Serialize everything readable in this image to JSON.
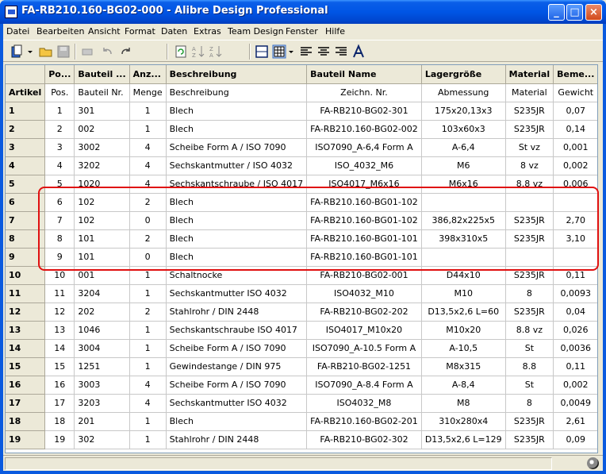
{
  "window": {
    "title": "FA-RB210.160-BG02-000 - Alibre Design Professional",
    "min": "_",
    "max": "□",
    "close": "×"
  },
  "menu": [
    "Datei",
    "Bearbeiten",
    "Ansicht",
    "Format",
    "Daten",
    "Extras",
    "Team Design",
    "Fenster",
    "Hilfe"
  ],
  "grid": {
    "columns": [
      "Po...",
      "Bauteil ...",
      "Anz...",
      "Beschreibung",
      "Bauteil Name",
      "Lagergröße",
      "Material",
      "Beme..."
    ],
    "subheader_label": "Artikel",
    "subheader": [
      "Pos.",
      "Bauteil Nr.",
      "Menge",
      "Beschreibung",
      "Zeichn. Nr.",
      "Abmessung",
      "Material",
      "Gewicht"
    ],
    "rows": [
      {
        "n": "1",
        "cells": [
          "1",
          "301",
          "1",
          "Blech",
          "FA-RB210-BG02-301",
          "175x20,13x3",
          "S235JR",
          "0,07"
        ]
      },
      {
        "n": "2",
        "cells": [
          "2",
          "002",
          "1",
          "Blech",
          "FA-RB210.160-BG02-002",
          "103x60x3",
          "S235JR",
          "0,14"
        ]
      },
      {
        "n": "3",
        "cells": [
          "3",
          "3002",
          "4",
          "Scheibe Form A / ISO 7090",
          "ISO7090_A-6,4 Form A",
          "A-6,4",
          "St vz",
          "0,001"
        ]
      },
      {
        "n": "4",
        "cells": [
          "4",
          "3202",
          "4",
          "Sechskantmutter / ISO 4032",
          "ISO_4032_M6",
          "M6",
          "8 vz",
          "0,002"
        ]
      },
      {
        "n": "5",
        "cells": [
          "5",
          "1020",
          "4",
          "Sechskantschraube / ISO 4017",
          "ISO4017_M6x16",
          "M6x16",
          "8.8 vz",
          "0,006"
        ]
      },
      {
        "n": "6",
        "cells": [
          "6",
          "102",
          "2",
          "Blech",
          "FA-RB210.160-BG01-102",
          "",
          "",
          ""
        ]
      },
      {
        "n": "7",
        "cells": [
          "7",
          "102",
          "0",
          "Blech",
          "FA-RB210.160-BG01-102",
          "386,82x225x5",
          "S235JR",
          "2,70"
        ]
      },
      {
        "n": "8",
        "cells": [
          "8",
          "101",
          "2",
          "Blech",
          "FA-RB210.160-BG01-101",
          "398x310x5",
          "S235JR",
          "3,10"
        ]
      },
      {
        "n": "9",
        "cells": [
          "9",
          "101",
          "0",
          "Blech",
          "FA-RB210.160-BG01-101",
          "",
          "",
          ""
        ]
      },
      {
        "n": "10",
        "cells": [
          "10",
          "001",
          "1",
          "Schaltnocke",
          "FA-RB210-BG02-001",
          "D44x10",
          "S235JR",
          "0,11"
        ]
      },
      {
        "n": "11",
        "cells": [
          "11",
          "3204",
          "1",
          "Sechskantmutter ISO 4032",
          "ISO4032_M10",
          "M10",
          "8",
          "0,0093"
        ]
      },
      {
        "n": "12",
        "cells": [
          "12",
          "202",
          "2",
          "Stahlrohr / DIN 2448",
          "FA-RB210-BG02-202",
          "D13,5x2,6 L=60",
          "S235JR",
          "0,04"
        ]
      },
      {
        "n": "13",
        "cells": [
          "13",
          "1046",
          "1",
          "Sechskantschraube ISO 4017",
          "ISO4017_M10x20",
          "M10x20",
          "8.8 vz",
          "0,026"
        ]
      },
      {
        "n": "14",
        "cells": [
          "14",
          "3004",
          "1",
          "Scheibe Form A / ISO 7090",
          "ISO7090_A-10.5 Form A",
          "A-10,5",
          "St",
          "0,0036"
        ]
      },
      {
        "n": "15",
        "cells": [
          "15",
          "1251",
          "1",
          "Gewindestange / DIN 975",
          "FA-RB210-BG02-1251",
          "M8x315",
          "8.8",
          "0,11"
        ]
      },
      {
        "n": "16",
        "cells": [
          "16",
          "3003",
          "4",
          "Scheibe Form A / ISO 7090",
          "ISO7090_A-8.4 Form A",
          "A-8,4",
          "St",
          "0,002"
        ]
      },
      {
        "n": "17",
        "cells": [
          "17",
          "3203",
          "4",
          "Sechskantmutter ISO 4032",
          "ISO4032_M8",
          "M8",
          "8",
          "0,0049"
        ]
      },
      {
        "n": "18",
        "cells": [
          "18",
          "201",
          "1",
          "Blech",
          "FA-RB210.160-BG02-201",
          "310x280x4",
          "S235JR",
          "2,61"
        ]
      },
      {
        "n": "19",
        "cells": [
          "19",
          "302",
          "1",
          "Stahlrohr / DIN 2448",
          "FA-RB210-BG02-302",
          "D13,5x2,6 L=129",
          "S235JR",
          "0,09"
        ]
      }
    ]
  },
  "colors": {
    "highlight": "#e01010",
    "titlebar": "#0055e5"
  }
}
